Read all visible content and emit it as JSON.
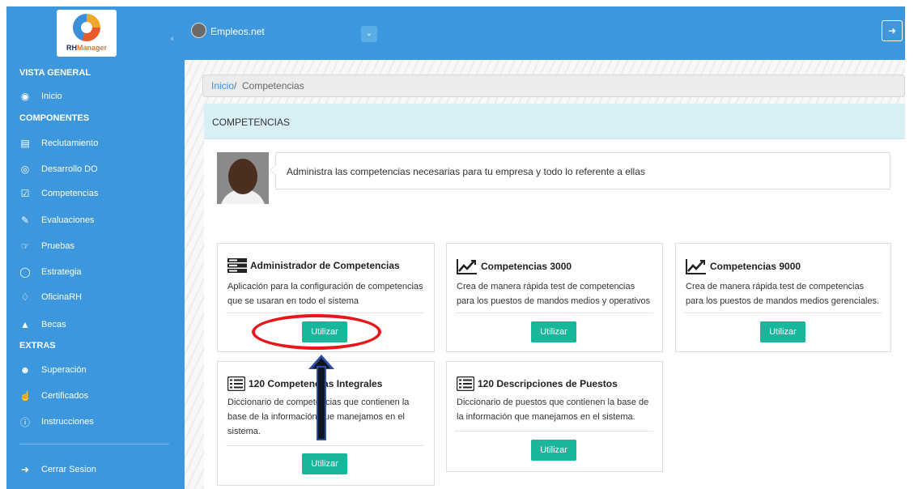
{
  "app": {
    "logo_text_a": "RH",
    "logo_text_b": "Manager",
    "brand": "Empleos.net",
    "accent": "#3d97dc",
    "button_color": "#1ab69b"
  },
  "sidebar": {
    "sections": [
      {
        "label": "VISTA GENERAL"
      },
      {
        "label": "COMPONENTES"
      },
      {
        "label": "EXTRAS"
      }
    ],
    "items": [
      {
        "label": "Inicio",
        "icon": "dashboard-icon"
      },
      {
        "label": "Reclutamiento",
        "icon": "calendar-icon"
      },
      {
        "label": "Desarrollo DO",
        "icon": "eye-icon"
      },
      {
        "label": "Competencias",
        "icon": "checkbox-icon"
      },
      {
        "label": "Evaluaciones",
        "icon": "edit-icon"
      },
      {
        "label": "Pruebas",
        "icon": "hand-icon"
      },
      {
        "label": "Estrategia",
        "icon": "lightbulb-icon"
      },
      {
        "label": "OficinaRH",
        "icon": "diamond-icon"
      },
      {
        "label": "Becas",
        "icon": "graduation-cap-icon"
      },
      {
        "label": "Superación",
        "icon": "users-icon"
      },
      {
        "label": "Certificados",
        "icon": "pointer-icon"
      },
      {
        "label": "Instrucciones",
        "icon": "info-icon"
      },
      {
        "label": "Cerrar Sesion",
        "icon": "sign-out-icon"
      }
    ]
  },
  "breadcrumb": {
    "home": "Inicio",
    "separator": "/",
    "current": "Competencias"
  },
  "panel": {
    "heading": "COMPETENCIAS",
    "intro": "Administra las competencias necesarias para tu empresa y todo lo referente a ellas"
  },
  "cards": [
    {
      "title": "Administrador de Competencias",
      "icon": "server-icon",
      "desc1": "Aplicación para la configuración de competencias",
      "desc2": "que se usaran en todo el sistema",
      "button": "Utilizar"
    },
    {
      "title": "Competencias 3000",
      "icon": "line-chart-icon",
      "desc1": "Crea de manera rápida test de competencias",
      "desc2": "para los puestos de mandos medios y operativos",
      "button": "Utilizar"
    },
    {
      "title": "Competencias 9000",
      "icon": "line-chart-icon",
      "desc1": "Crea de manera rápida test de competencias",
      "desc2": "para los puestos de mandos medios gerenciales.",
      "button": "Utilizar"
    },
    {
      "title": "120 Competencias Integrales",
      "icon": "list-icon",
      "desc1": "Diccionario de competencias que contienen la",
      "desc2": "base de la información que manejamos en el",
      "desc3": "sistema.",
      "button": "Utilizar"
    },
    {
      "title": "120 Descripciones de Puestos",
      "icon": "list-icon",
      "desc1": "Diccionario de puestos que contienen la base de",
      "desc2": "la información que manejamos en el sistema.",
      "button": "Utilizar"
    }
  ]
}
